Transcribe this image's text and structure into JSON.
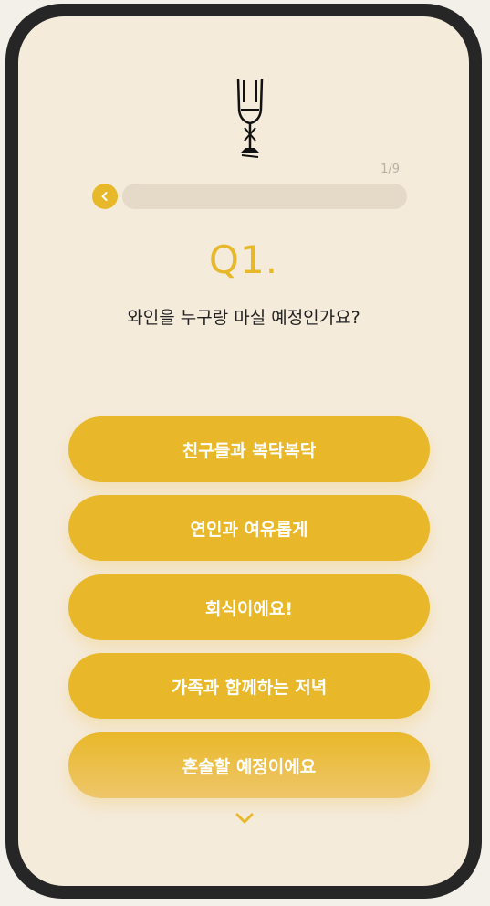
{
  "progress": {
    "label": "1/9",
    "current": 1,
    "total": 9
  },
  "question": {
    "number": "Q1.",
    "text": "와인을 누구랑 마실 예정인가요?"
  },
  "answers": [
    {
      "label": "친구들과 복닥복닥"
    },
    {
      "label": "연인과 여유롭게"
    },
    {
      "label": "회식이에요!"
    },
    {
      "label": "가족과 함께하는 저녁"
    },
    {
      "label": "혼술할 예정이에요"
    }
  ],
  "icons": {
    "logo": "wine-glass-icon",
    "back": "chevron-left-icon",
    "scroll": "chevron-down-icon"
  },
  "colors": {
    "accent": "#e9b82a",
    "background": "#f5ebdb",
    "track": "#e5d9c8"
  }
}
